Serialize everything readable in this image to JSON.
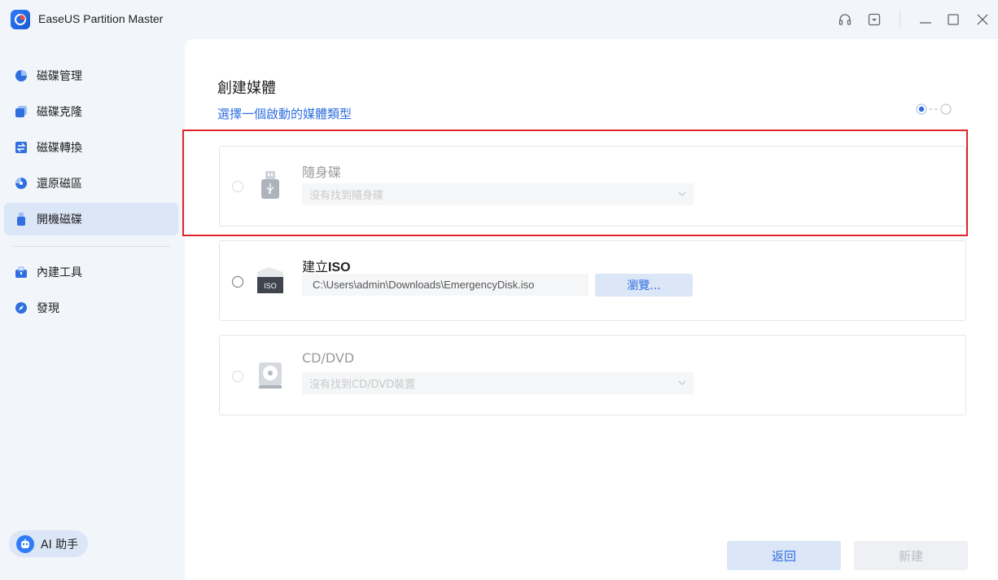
{
  "app": {
    "title": "EaseUS Partition Master"
  },
  "titlebar": {
    "icons": [
      "headset-icon",
      "dropdown-menu-icon",
      "minimize-icon",
      "maximize-icon",
      "close-icon"
    ]
  },
  "sidebar": {
    "items": [
      {
        "label": "磁碟管理",
        "icon": "pie-chart-icon",
        "active": false
      },
      {
        "label": "磁碟克隆",
        "icon": "clone-icon",
        "active": false
      },
      {
        "label": "磁碟轉換",
        "icon": "convert-icon",
        "active": false
      },
      {
        "label": "還原磁區",
        "icon": "recover-icon",
        "active": false
      },
      {
        "label": "開機磁碟",
        "icon": "usb-icon",
        "active": true
      },
      {
        "label": "內建工具",
        "icon": "toolbox-icon",
        "active": false
      },
      {
        "label": "發現",
        "icon": "compass-icon",
        "active": false
      }
    ],
    "ai_button": {
      "label": "AI 助手",
      "icon": "robot-icon"
    }
  },
  "main": {
    "title": "創建媒體",
    "subtitle": "選擇一個啟動的媒體類型",
    "options": [
      {
        "id": "usb",
        "label": "隨身碟",
        "select_value": "沒有找到隨身碟",
        "enabled": false,
        "icon": "usb-drive-icon"
      },
      {
        "id": "iso",
        "label_prefix": "建立",
        "label_bold": "ISO",
        "path": "C:\\Users\\admin\\Downloads\\EmergencyDisk.iso",
        "browse_label": "瀏覽...",
        "enabled": true,
        "icon": "iso-folder-icon"
      },
      {
        "id": "cd",
        "label": "CD/DVD",
        "select_value": "沒有找到CD/DVD裝置",
        "enabled": false,
        "icon": "cd-drive-icon"
      }
    ],
    "buttons": {
      "back": "返回",
      "create": "新建"
    }
  },
  "colors": {
    "accent": "#2f6fe0",
    "highlight": "#e0262a",
    "active_nav": "#dbe6f7"
  }
}
